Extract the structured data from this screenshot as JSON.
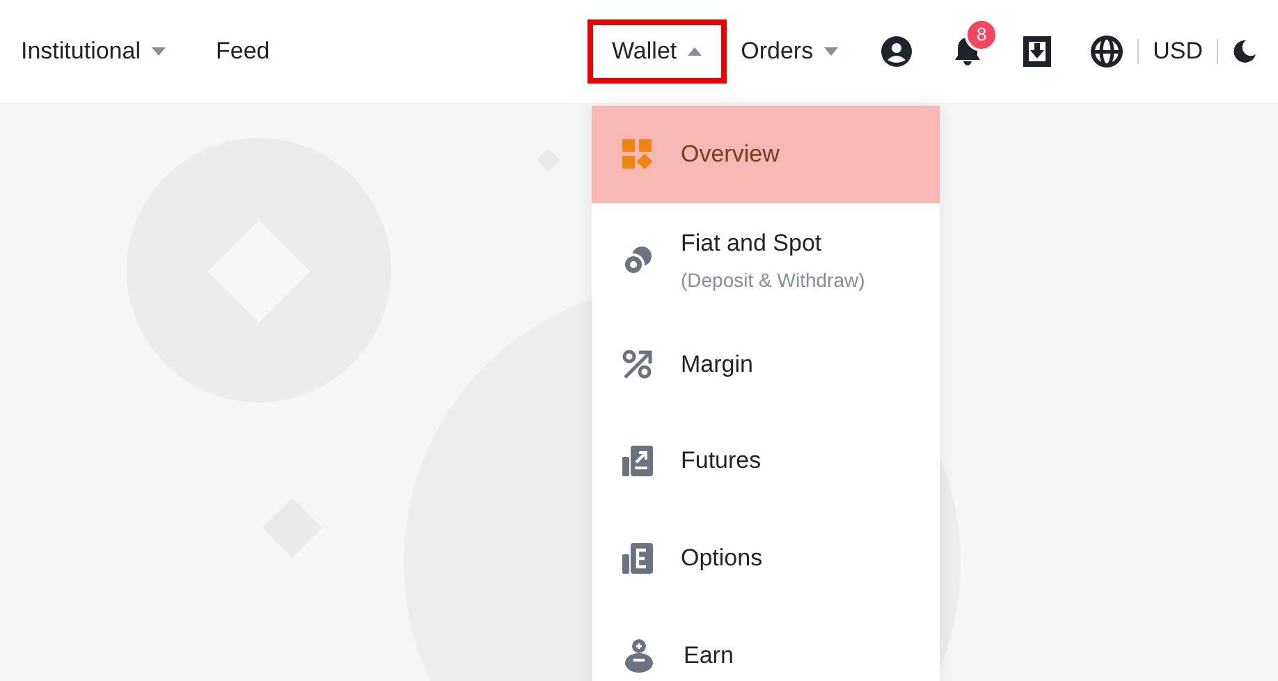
{
  "nav": [
    {
      "label": "Institutional",
      "kind": "dropdown",
      "expanded": false,
      "highlighted": false
    },
    {
      "label": "Feed",
      "kind": "link",
      "highlighted": false
    }
  ],
  "nav_right": [
    {
      "label": "Wallet",
      "kind": "dropdown",
      "expanded": true,
      "highlighted": true
    },
    {
      "label": "Orders",
      "kind": "dropdown",
      "expanded": false,
      "highlighted": false
    }
  ],
  "notifications_badge": "8",
  "currency": "USD",
  "wallet_menu": [
    {
      "label": "Overview",
      "kind": "overview",
      "selected": true
    },
    {
      "label": "Fiat and Spot",
      "sublabel": "(Deposit & Withdraw)",
      "kind": "fiat",
      "selected": false
    },
    {
      "label": "Margin",
      "kind": "margin",
      "selected": false
    },
    {
      "label": "Futures",
      "kind": "futures",
      "selected": false
    },
    {
      "label": "Options",
      "kind": "options",
      "selected": false
    },
    {
      "label": "Earn",
      "kind": "earn",
      "selected": false
    }
  ]
}
